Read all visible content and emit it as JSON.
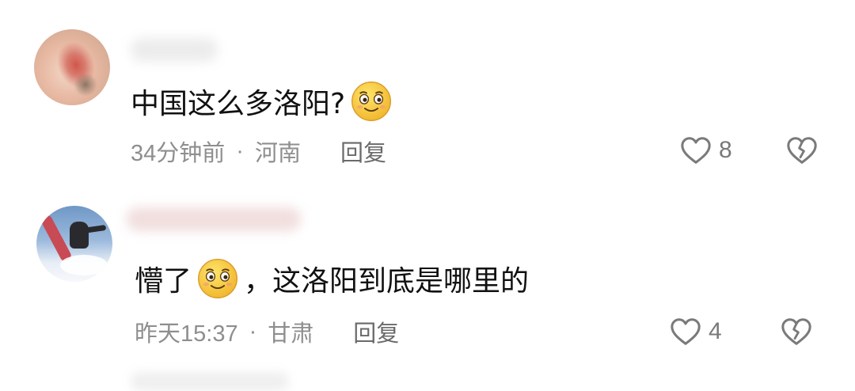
{
  "comments": [
    {
      "text_before": "中国这么多洛阳?",
      "text_after": "",
      "emoji": "smiling-face-emoji",
      "time": "34分钟前",
      "separator": "·",
      "location": "河南",
      "reply_label": "回复",
      "like_count": "8"
    },
    {
      "text_before": "懵了",
      "text_after": "，这洛阳到底是哪里的",
      "emoji": "smiling-face-emoji",
      "time": "昨天15:37",
      "separator": "·",
      "location": "甘肃",
      "reply_label": "回复",
      "like_count": "4"
    }
  ],
  "icons": {
    "like": "heart-outline-icon",
    "dislike": "broken-heart-outline-icon"
  },
  "colors": {
    "text": "#111111",
    "meta": "#8e8e8e",
    "icon": "#7a7a7a",
    "emoji_face": "#f6c431"
  }
}
